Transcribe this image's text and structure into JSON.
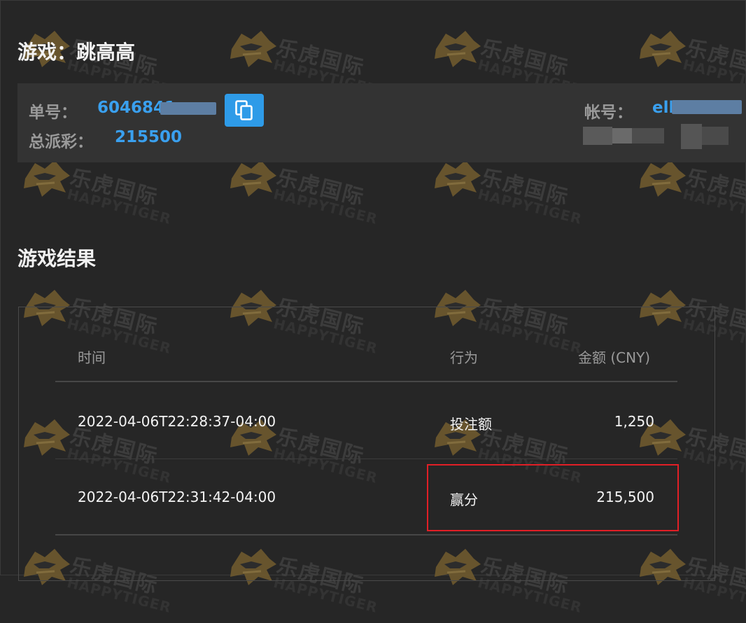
{
  "game": {
    "label": "游戏",
    "separator": "：",
    "name": "跳高高"
  },
  "info": {
    "order_label": "单号：",
    "order_value": "6046841",
    "payout_label": "总派彩：",
    "payout_value": "215500",
    "account_label": "帐号：",
    "account_value": "ell",
    "copy_icon": "copy-icon"
  },
  "results": {
    "title": "游戏结果",
    "columns": {
      "time": "时间",
      "action": "行为",
      "amount": "金额 (CNY)"
    },
    "rows": [
      {
        "time": "2022-04-06T22:28:37-04:00",
        "action": "投注额",
        "amount": "1,250"
      },
      {
        "time": "2022-04-06T22:31:42-04:00",
        "action": "赢分",
        "amount": "215,500"
      }
    ]
  },
  "watermark": {
    "text": "乐虎国际",
    "sub": "HAPPYTIGER"
  },
  "colors": {
    "accent": "#3aa0ef",
    "highlight": "#e11f26",
    "background": "#262626",
    "panel": "#333333"
  }
}
